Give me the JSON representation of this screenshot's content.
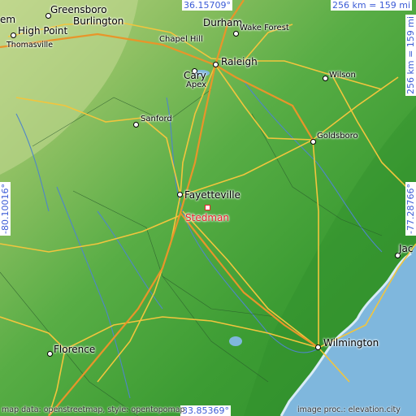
{
  "coordinates": {
    "top_lat": "36.15709°",
    "bottom_lat": "33.85369°",
    "left_lon": "-80.10016°",
    "right_lon": "-77.28766°"
  },
  "scale": {
    "horizontal": "256 km = 159 mi",
    "vertical": "256 km = 159 mi"
  },
  "target": {
    "name": "Stedman",
    "color": "#e8212b"
  },
  "cities": {
    "greensboro": "Greensboro",
    "burlington": "Burlington",
    "high_point": "High Point",
    "thomasville": "Thomasville",
    "em": "em",
    "durham": "Durham",
    "chapel_hill": "Chapel Hill",
    "wake_forest": "Wake Forest",
    "raleigh": "Raleigh",
    "cary": "Cary",
    "apex": "Apex",
    "wilson": "Wilson",
    "sanford": "Sanford",
    "goldsboro": "Goldsboro",
    "fayetteville": "Fayetteville",
    "jac": "Jac",
    "florence": "Florence",
    "wilmington": "Wilmington"
  },
  "credits": {
    "left": "map data: openstreetmap, style: opentopomap",
    "right": "image proc.: elevation.city"
  },
  "colors": {
    "land": "#3f9e35",
    "highlands": "#a8c56f",
    "water": "#7fb7dd",
    "roads": "#f2c53d",
    "coords_text": "#3b5bd6"
  }
}
